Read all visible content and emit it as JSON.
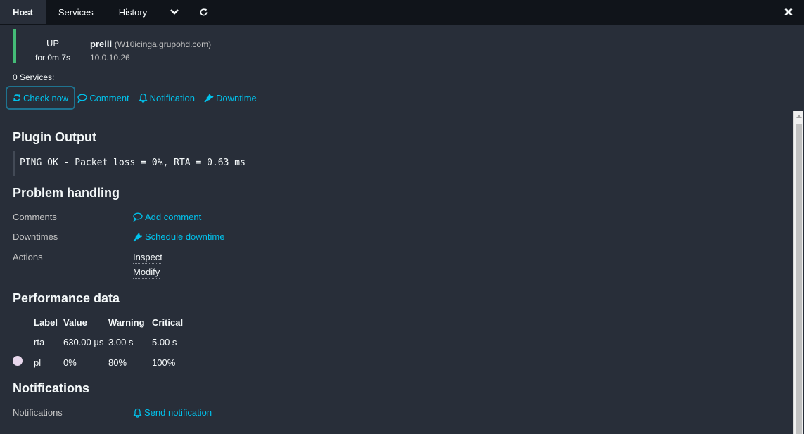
{
  "tabs": [
    {
      "label": "Host"
    },
    {
      "label": "Services"
    },
    {
      "label": "History"
    }
  ],
  "host": {
    "state": "UP",
    "since": "for 0m 7s",
    "name": "preiii",
    "display_name": "(W10icinga.grupohd.com)",
    "address": "10.0.10.26",
    "services_count": "0 Services:"
  },
  "actions": {
    "check_now": "Check now",
    "comment": "Comment",
    "notification": "Notification",
    "downtime": "Downtime"
  },
  "plugin_output": {
    "heading": "Plugin Output",
    "text": "PING OK - Packet loss = 0%, RTA = 0.63 ms"
  },
  "problem_handling": {
    "heading": "Problem handling",
    "comments_label": "Comments",
    "add_comment": "Add comment",
    "downtimes_label": "Downtimes",
    "schedule_downtime": "Schedule downtime",
    "actions_label": "Actions",
    "inspect": "Inspect",
    "modify": "Modify"
  },
  "performance": {
    "heading": "Performance data",
    "columns": [
      "Label",
      "Value",
      "Warning",
      "Critical"
    ],
    "rows": [
      {
        "label": "rta",
        "value": "630.00 µs",
        "warning": "3.00 s",
        "critical": "5.00 s"
      },
      {
        "label": "pl",
        "value": "0%",
        "warning": "80%",
        "critical": "100%"
      }
    ]
  },
  "notifications": {
    "heading": "Notifications",
    "label": "Notifications",
    "send": "Send notification"
  },
  "colors": {
    "up": "#44bb77",
    "link": "#00c3ed",
    "background": "#282e39",
    "tabbar": "#10141a"
  },
  "icons": {
    "dropdown": "chevron-down-icon",
    "refresh": "refresh-icon",
    "close": "close-icon",
    "comment": "comment-icon",
    "bell": "bell-icon",
    "plug": "plug-icon"
  }
}
